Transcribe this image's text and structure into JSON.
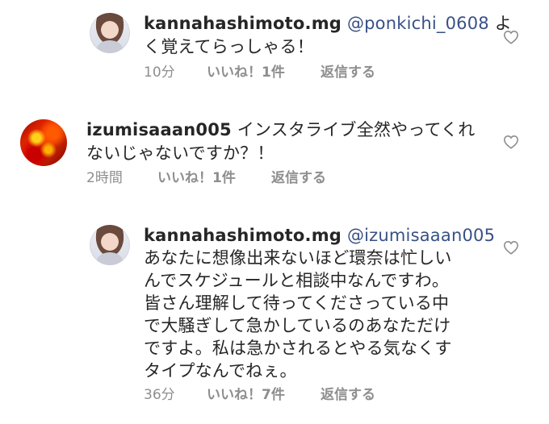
{
  "comments": [
    {
      "username": "kannahashimoto.mg",
      "mention": "@ponkichi_0608",
      "text_lines": [
        "よ",
        "く覚えてらっしゃる！"
      ],
      "time": "10分",
      "likes": "いいね！1件",
      "reply": "返信する",
      "avatar": "kannahashimoto-avatar",
      "icon": "heart-outline"
    },
    {
      "username": "izumisaaan005",
      "text_lines": [
        " インスタライブ全然やってくれ",
        "ないじゃないですか？！"
      ],
      "time": "2時間",
      "likes": "いいね！1件",
      "reply": "返信する",
      "avatar": "izumisaaan005-avatar",
      "icon": "heart-outline"
    },
    {
      "username": "kannahashimoto.mg",
      "mention": "@izumisaaan005",
      "text_lines": [
        "あなたに想像出来ないほど環奈は忙しい",
        "んでスケジュールと相談中なんですわ。",
        "皆さん理解して待ってくださっている中",
        "で大騒ぎして急かしているのあなただけ",
        "ですよ。私は急かされるとやる気なくす",
        "タイプなんでねぇ。"
      ],
      "time": "36分",
      "likes": "いいね！7件",
      "reply": "返信する",
      "avatar": "kannahashimoto-avatar",
      "icon": "heart-outline"
    }
  ],
  "colors": {
    "text": "#262626",
    "mention": "#385185",
    "meta": "#8e8e8e"
  }
}
